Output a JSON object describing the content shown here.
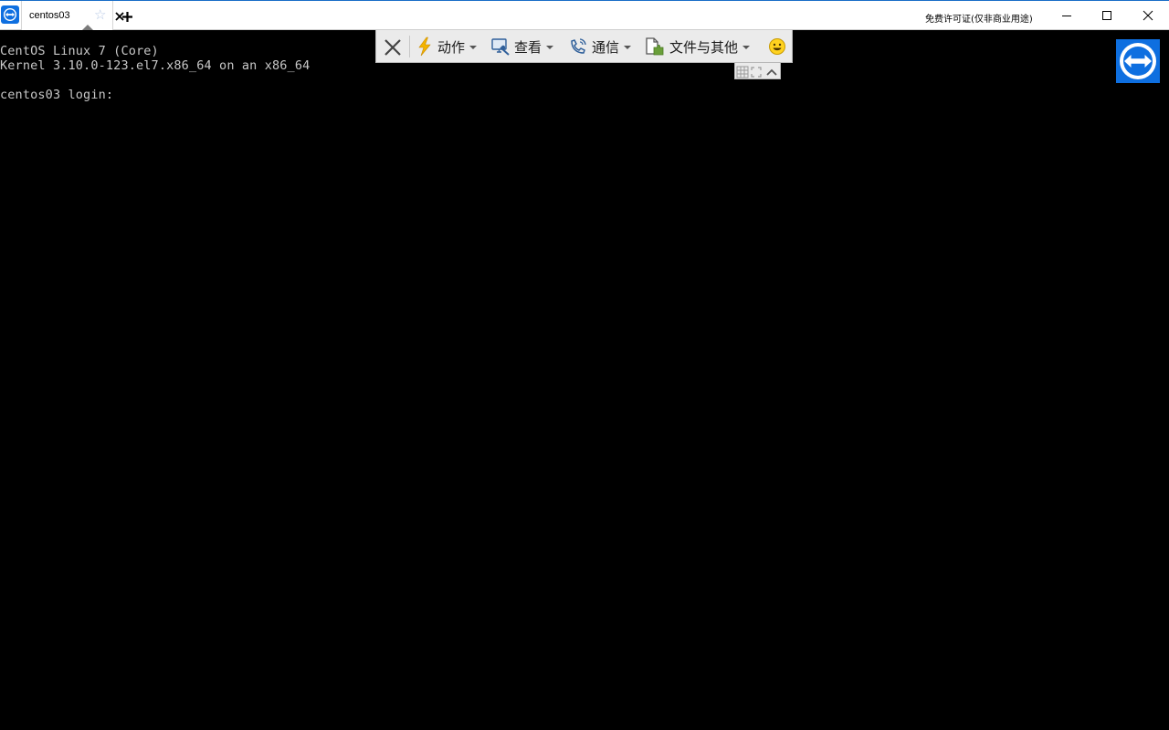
{
  "window": {
    "app_icon": "teamviewer-icon",
    "tab": {
      "label": "centos03",
      "favorite_icon": "star-icon",
      "close_icon": "close-icon"
    },
    "new_tab_icon": "plus-icon",
    "license_text": "免费许可证(仅非商业用途)",
    "controls": [
      "minimize-icon",
      "maximize-icon",
      "close-icon"
    ]
  },
  "terminal": {
    "lines": [
      "CentOS Linux 7 (Core)",
      "Kernel 3.10.0-123.el7.x86_64 on an x86_64",
      "centos03 login:"
    ]
  },
  "remote_toolbar": {
    "close_icon": "close-icon",
    "menus": [
      {
        "label": "动作",
        "icon": "lightning-icon"
      },
      {
        "label": "查看",
        "icon": "monitor-icon"
      },
      {
        "label": "通信",
        "icon": "phone-icon"
      },
      {
        "label": "文件与其他",
        "icon": "file-puzzle-icon"
      }
    ],
    "feedback_icon": "smiley-icon",
    "sub_icons": [
      "grid-icon",
      "fullscreen-icon",
      "chevron-up-icon"
    ]
  },
  "colors": {
    "brand_blue": "#0e6fe0",
    "terminal_bg": "#000000",
    "terminal_text": "#c8c8c8",
    "toolbar_bg": "#ebebeb"
  }
}
